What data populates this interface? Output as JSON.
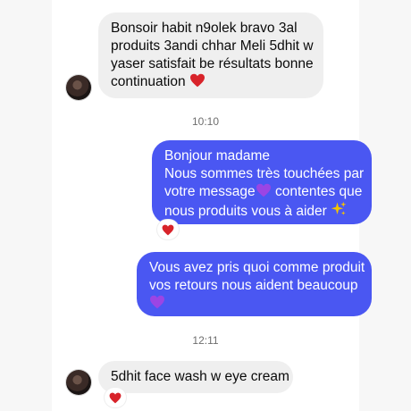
{
  "thread": {
    "messages": [
      {
        "direction": "incoming",
        "lines": [
          "Bonsoir habit n9olek bravo 3al",
          "produits 3andi chhar Meli 5dhit w",
          "yaser satisfait be résultats bonne",
          "continuation"
        ],
        "emoji": "red-heart"
      },
      {
        "timestamp": "10:10"
      },
      {
        "direction": "outgoing",
        "lines": [
          "Bonjour madame",
          "Nous sommes très touchées par",
          "votre message",
          "contentes que",
          "nous produits vous à aider"
        ],
        "emoji": [
          "purple-heart",
          "sparkles"
        ],
        "reaction": "red-heart"
      },
      {
        "direction": "outgoing",
        "lines": [
          "Vous avez pris quoi comme produit",
          "vos retours nous aident beaucoup"
        ],
        "emoji": "purple-heart"
      },
      {
        "timestamp": "12:11"
      },
      {
        "direction": "incoming",
        "lines": [
          "5dhit face wash w eye cream"
        ],
        "reaction": "red-heart"
      }
    ]
  },
  "colors": {
    "outgoing_bubble": "#4a57f2",
    "incoming_bubble": "#efefef",
    "heart_red": "#d8232a",
    "heart_purple": "#9b45e4",
    "sparkle": "#f5c400"
  }
}
